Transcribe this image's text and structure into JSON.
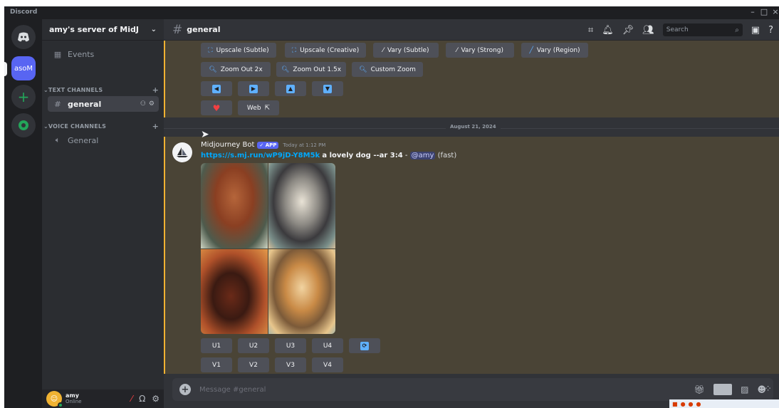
{
  "window": {
    "title": "Discord",
    "controls": [
      "–",
      "□",
      "×"
    ]
  },
  "servers": {
    "home_icon": "discord-logo-icon",
    "active_label": "asoM",
    "add_icon": "plus-icon",
    "explore_icon": "compass-icon"
  },
  "sidebar": {
    "server_name": "amy's server of MidJ",
    "events_label": "Events",
    "text_category": "TEXT CHANNELS",
    "text_channels": [
      "general"
    ],
    "voice_category": "VOICE CHANNELS",
    "voice_channels": [
      "General"
    ]
  },
  "user": {
    "name": "amy",
    "status": "Online"
  },
  "header": {
    "channel": "general",
    "search_placeholder": "Search",
    "icons": [
      "threads-icon",
      "bell-icon",
      "pin-icon",
      "members-icon",
      "inbox-icon",
      "help-icon"
    ]
  },
  "prev_message": {
    "row1": [
      "Upscale (Subtle)",
      "Upscale (Creative)",
      "Vary (Subtle)",
      "Vary (Strong)",
      "Vary (Region)"
    ],
    "row2": [
      "Zoom Out 2x",
      "Zoom Out 1.5x",
      "Custom Zoom"
    ],
    "row3": [
      "arrow-left-icon",
      "arrow-right-icon",
      "arrow-up-icon",
      "arrow-down-icon"
    ],
    "web_label": "Web"
  },
  "date_divider": "August 21, 2024",
  "bot_message": {
    "author": "Midjourney Bot",
    "tag": "✓ APP",
    "timestamp": "Today at 1:12 PM",
    "link": "https://s.mj.run/wP9jD-Y8M5k",
    "prompt": "a lovely dog --ar 3:4",
    "separator": " - ",
    "mention": "@amy",
    "mode": "(fast)",
    "upscale_buttons": [
      "U1",
      "U2",
      "U3",
      "U4"
    ],
    "variation_buttons": [
      "V1",
      "V2",
      "V3",
      "V4"
    ]
  },
  "composer": {
    "placeholder": "Message #general"
  },
  "colors": {
    "blurple": "#5865f2",
    "highlight": "#4a4436",
    "highlight_bar": "#f0b232",
    "online": "#23a55a"
  }
}
